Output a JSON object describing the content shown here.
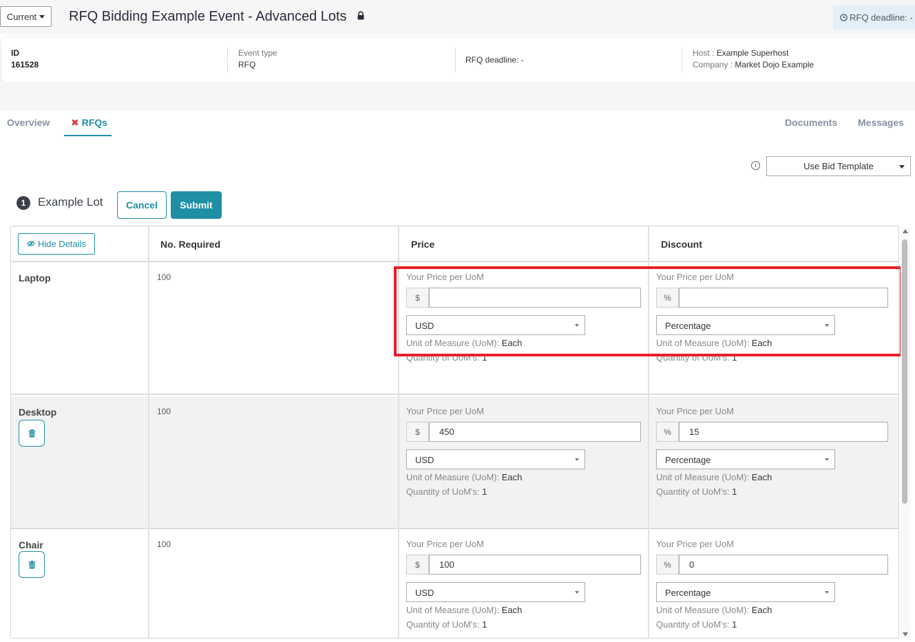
{
  "header": {
    "current_label": "Current",
    "title": "RFQ Bidding Example Event - Advanced Lots",
    "deadline_pill": "RFQ deadline: -"
  },
  "info": {
    "id_label": "ID",
    "id_value": "161528",
    "event_type_label": "Event type",
    "event_type_value": "RFQ",
    "deadline": "RFQ deadline: -",
    "host_label": "Host :",
    "host_value": "Example Superhost",
    "company_label": "Company :",
    "company_value": "Market Dojo Example"
  },
  "tabs": {
    "overview": "Overview",
    "rfqs": "RFQs",
    "documents": "Documents",
    "messages": "Messages"
  },
  "template": {
    "info_symbol": "i",
    "label": "Use Bid Template"
  },
  "lot": {
    "number": "1",
    "title": "Example Lot",
    "cancel": "Cancel",
    "submit": "Submit"
  },
  "table": {
    "hide_details": "Hide Details",
    "headers": {
      "required": "No. Required",
      "price": "Price",
      "discount": "Discount"
    },
    "price_label": "Your Price per UoM",
    "currency_symbol": "$",
    "percent_symbol": "%",
    "uom_label": "Unit of Measure (UoM):",
    "qty_label": "Quantity of UoM's:",
    "rows": [
      {
        "name": "Laptop",
        "required": "100",
        "price": "",
        "currency": "USD",
        "discount": "",
        "discount_type": "Percentage",
        "uom": "Each",
        "qty": "1"
      },
      {
        "name": "Desktop",
        "required": "100",
        "price": "450",
        "currency": "USD",
        "discount": "15",
        "discount_type": "Percentage",
        "uom": "Each",
        "qty": "1"
      },
      {
        "name": "Chair",
        "required": "100",
        "price": "100",
        "currency": "USD",
        "discount": "0",
        "discount_type": "Percentage",
        "uom": "Each",
        "qty": "1"
      }
    ]
  },
  "colors": {
    "accent": "#1f8fa6",
    "highlight": "#e8202a"
  }
}
